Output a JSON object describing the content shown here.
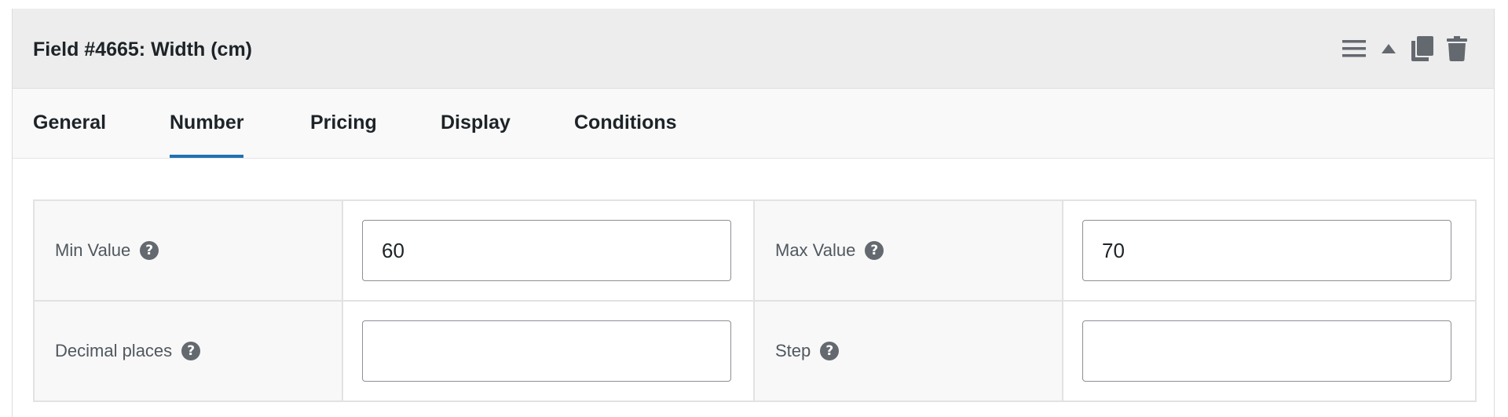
{
  "header": {
    "title": "Field #4665: Width (cm)",
    "actions": [
      {
        "name": "menu-icon"
      },
      {
        "name": "collapse-arrow-icon"
      },
      {
        "name": "duplicate-icon"
      },
      {
        "name": "trash-icon"
      }
    ]
  },
  "tabs": [
    {
      "label": "General",
      "active": false
    },
    {
      "label": "Number",
      "active": true
    },
    {
      "label": "Pricing",
      "active": false
    },
    {
      "label": "Display",
      "active": false
    },
    {
      "label": "Conditions",
      "active": false
    }
  ],
  "fields": {
    "min_value": {
      "label": "Min Value",
      "value": "60",
      "help": "?"
    },
    "max_value": {
      "label": "Max Value",
      "value": "70",
      "help": "?"
    },
    "decimal_places": {
      "label": "Decimal places",
      "value": "",
      "help": "?"
    },
    "step": {
      "label": "Step",
      "value": "",
      "help": "?"
    }
  },
  "colors": {
    "accent": "#2271b1",
    "header_bg": "#ededed",
    "icon": "#646970"
  }
}
